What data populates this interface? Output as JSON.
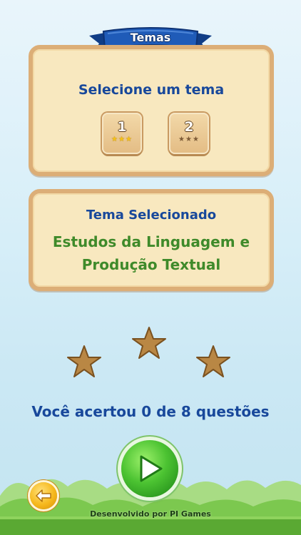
{
  "header": {
    "title": "Temas"
  },
  "themes_panel": {
    "title": "Selecione um tema",
    "buttons": [
      {
        "label": "1",
        "stars": "★★★",
        "star_color": "gold"
      },
      {
        "label": "2",
        "stars": "★★★",
        "star_color": "brown"
      }
    ]
  },
  "selected_panel": {
    "title": "Tema Selecionado",
    "line1": "Estudos da Linguagem e",
    "line2": "Produção Textual"
  },
  "stars_earned": 0,
  "stars_total": 3,
  "result_text": "Você acertou 0 de 8 questões",
  "footer": "Desenvolvido por PI Games",
  "colors": {
    "title_blue": "#18489b",
    "theme_green": "#3f8a2a",
    "panel_fill": "#f8e8bf",
    "panel_border": "#dcae77",
    "star_brown": "#b98744",
    "ribbon_blue": "#1f5bb8"
  },
  "icons": {
    "play": "play-icon",
    "back": "arrow-left-icon"
  }
}
